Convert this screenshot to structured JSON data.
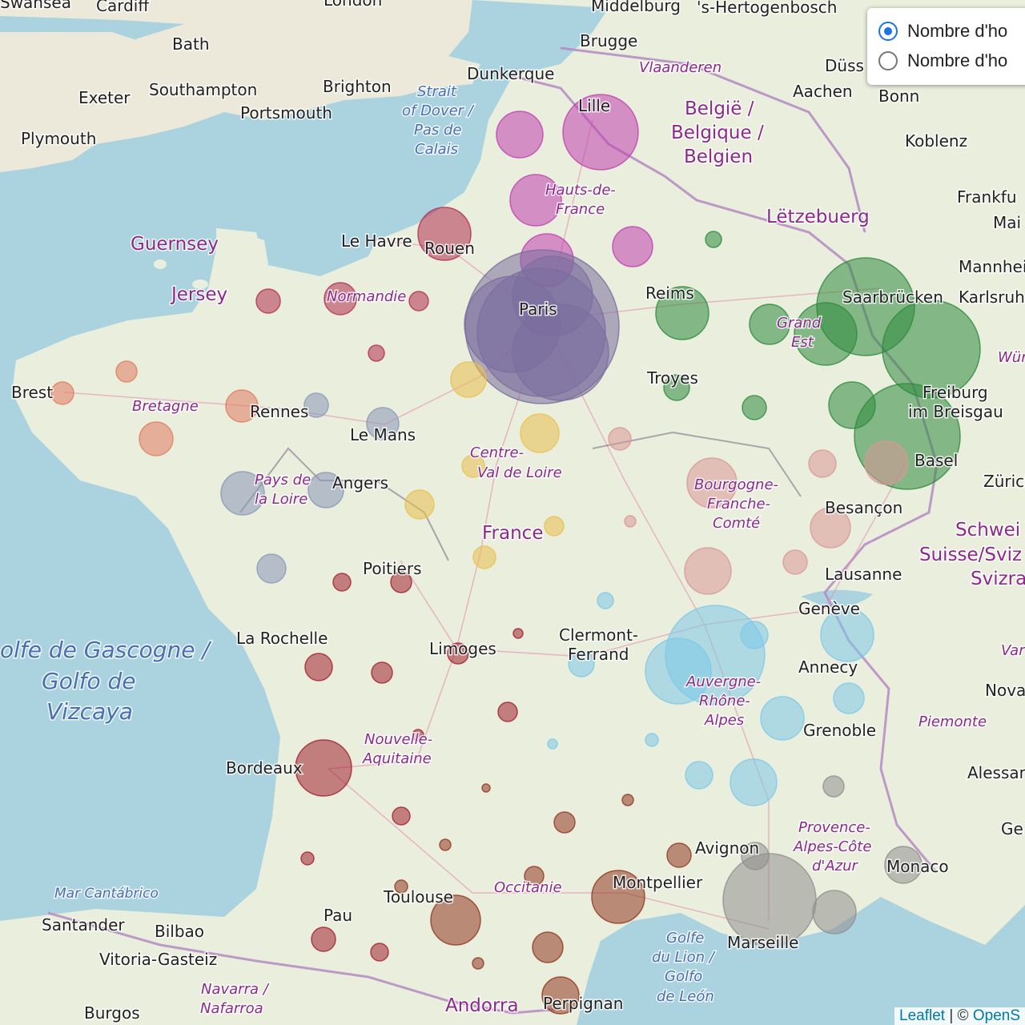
{
  "layer_control": {
    "options": [
      {
        "label": "Nombre d'ho",
        "selected": true
      },
      {
        "label": "Nombre d'ho",
        "selected": false
      }
    ]
  },
  "attribution": {
    "leaflet": "Leaflet",
    "separator": " | © ",
    "osm": "OpenS"
  },
  "labels": {
    "cities": [
      "Swansea",
      "Cardiff",
      "London",
      "Middelburg",
      "'s-Hertogenbosch",
      "Bath",
      "Brugge",
      "Düss",
      "Southampton",
      "Brighton",
      "Dunkerque",
      "Aachen",
      "Bonn",
      "Exeter",
      "Portsmouth",
      "Lille",
      "Plymouth",
      "Koblenz",
      "Frankfu",
      "Mai",
      "Le Havre",
      "Rouen",
      "Mannhei",
      "Reims",
      "Saarbrücken",
      "Karlsruh",
      "Paris",
      "Troyes",
      "Brest",
      "Rennes",
      "Le Mans",
      "Freiburg",
      "im Breisgau",
      "Angers",
      "Basel",
      "Zürich",
      "Besançon",
      "Poitiers",
      "Lausanne",
      "Genève",
      "La Rochelle",
      "Limoges",
      "Clermont-",
      "Ferrand",
      "Annecy",
      "Nova",
      "Grenoble",
      "Bordeaux",
      "Alessan",
      "Avignon",
      "Ge",
      "Monaco",
      "Montpellier",
      "Toulouse",
      "Marseille",
      "Santander",
      "Bilbao",
      "Pau",
      "Vitoria-Gasteiz",
      "Burgos",
      "Perpignan"
    ],
    "regions": [
      "Vlaanderen",
      "Hauts-de-",
      "France",
      "Normandie",
      "Bretagne",
      "Pays de",
      "la Loire",
      "Centre-",
      "Val de Loire",
      "Grand",
      "Est",
      "Bourgogne-",
      "Franche-",
      "Comté",
      "Auvergne-",
      "Rhône-",
      "Alpes",
      "Nouvelle-",
      "Aquitaine",
      "Occitanie",
      "Provence-",
      "Alpes-Côte",
      "d'Azur",
      "Piemonte",
      "Navarra /",
      "Nafarroa",
      "Wür",
      "Var"
    ],
    "countries": [
      "België /",
      "Belgique /",
      "Belgien",
      "Lëtzebuerg",
      "France",
      "Guernsey",
      "Jersey",
      "Schwei",
      "Suisse/Sviz",
      "Svizra",
      "Andorra"
    ],
    "seas": [
      "Strait",
      "of Dover /",
      "Pas de",
      "Calais",
      "olfe de Gascogne /",
      "Golfo de",
      "Vizcaya",
      "Mar Cantábrico",
      "Golfe",
      "du Lion /",
      "Golfo",
      "de León"
    ]
  },
  "colors": {
    "hauts_de_france": "#c040b0",
    "normandie": "#b03050",
    "ile_de_france": "#7a6e9e",
    "grand_est": "#2e8b3e",
    "bretagne": "#e07a60",
    "pays_de_la_loire": "#8898b8",
    "centre_val_de_loire": "#e8c050",
    "bourgogne_franche_comte": "#d89898",
    "auvergne_rhone_alpes": "#7ec8e8",
    "nouvelle_aquitaine": "#a02030",
    "occitanie": "#903820",
    "paca": "#909090",
    "sea": "#aad3df",
    "land": "#f2efe9"
  }
}
